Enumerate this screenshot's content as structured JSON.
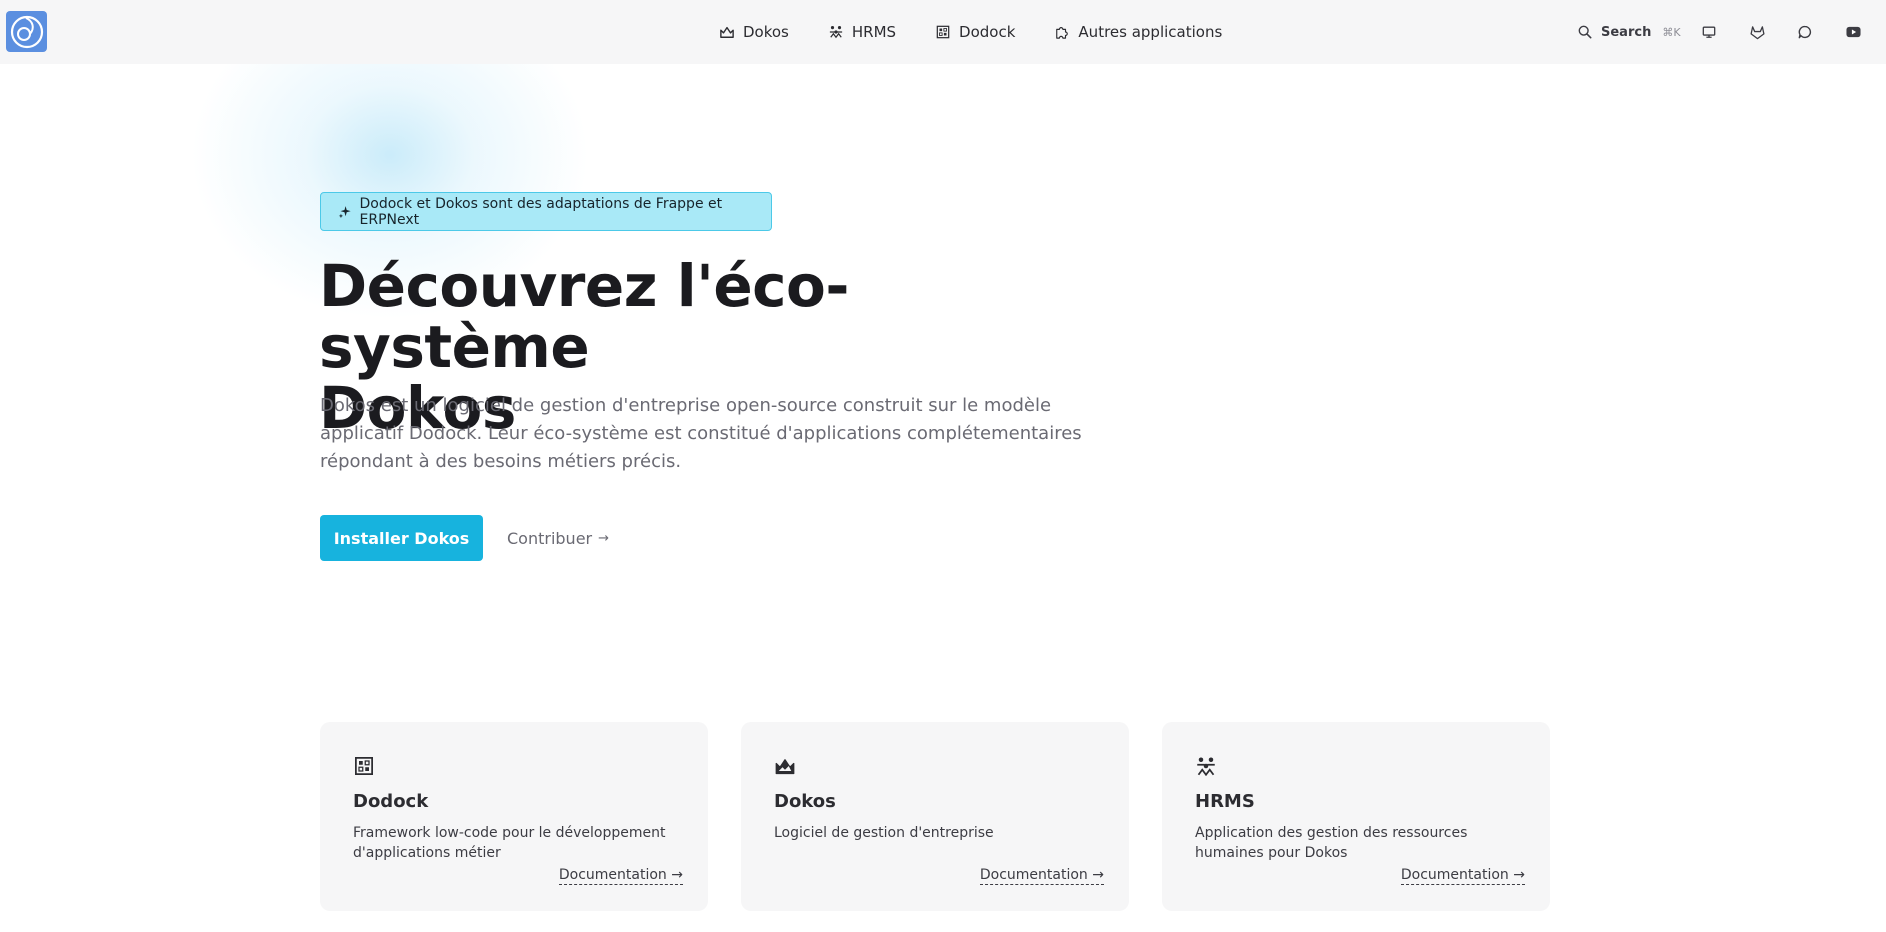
{
  "header": {
    "logo_icon": "dokos-logo-icon",
    "nav": [
      {
        "label": "Dokos",
        "icon": "dokos-mountain-icon"
      },
      {
        "label": "HRMS",
        "icon": "people-icon"
      },
      {
        "label": "Dodock",
        "icon": "grid-icon"
      },
      {
        "label": "Autres applications",
        "icon": "puzzle-icon"
      }
    ],
    "search": {
      "label": "Search",
      "shortcut": "⌘K"
    },
    "social_icons": [
      "monitor-icon",
      "gitlab-icon",
      "chat-icon",
      "youtube-icon"
    ]
  },
  "hero": {
    "badge": "Dodock et Dokos sont des adaptations de Frappe et ERPNext",
    "title_line1": "Découvrez l'éco-système",
    "title_line2": "Dokos",
    "description": "Dokos est un logiciel de gestion d'entreprise open-source construit sur le modèle applicatif Dodock. Leur éco-système est constitué d'applications complétementaires répondant à des besoins métiers précis.",
    "primary_button": "Installer Dokos",
    "secondary_link": "Contribuer",
    "secondary_arrow": "→"
  },
  "cards": [
    {
      "title": "Dodock",
      "description": "Framework low-code pour le développement d'applications métier",
      "link": "Documentation",
      "icon": "grid-icon"
    },
    {
      "title": "Dokos",
      "description": "Logiciel de gestion d'entreprise",
      "link": "Documentation",
      "icon": "dokos-mountain-icon"
    },
    {
      "title": "HRMS",
      "description": "Application des gestion des ressources humaines pour Dokos",
      "link": "Documentation",
      "icon": "people-icon"
    }
  ],
  "colors": {
    "accent": "#17b3de",
    "badge_bg": "#a9e9f7",
    "badge_border": "#4cc9e8",
    "nav_bg": "#f6f6f7",
    "card_bg": "#f6f6f7"
  }
}
